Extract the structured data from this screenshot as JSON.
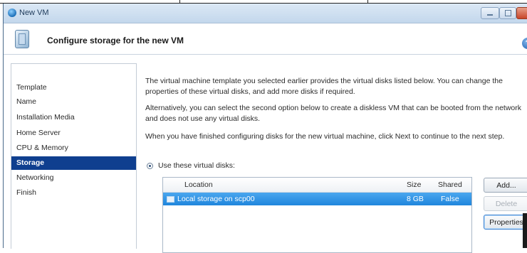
{
  "window": {
    "title": "New VM",
    "icon": "xen-orb-icon"
  },
  "header": {
    "title": "Configure storage for the new VM",
    "icon": "storage-wizard-icon",
    "help_glyph": "?"
  },
  "sidebar": {
    "items": [
      {
        "label": "Template",
        "active": false
      },
      {
        "label": "Name",
        "active": false
      },
      {
        "label": "Installation Media",
        "active": false
      },
      {
        "label": "Home Server",
        "active": false
      },
      {
        "label": "CPU & Memory",
        "active": false
      },
      {
        "label": "Storage",
        "active": true
      },
      {
        "label": "Networking",
        "active": false
      },
      {
        "label": "Finish",
        "active": false
      }
    ]
  },
  "content": {
    "para1": "The virtual machine template you selected earlier provides the virtual disks listed below. You can change the properties of these virtual disks, and add more disks if required.",
    "para2": "Alternatively, you can select the second option below to create a diskless VM that can be booted from the network and does not use any virtual disks.",
    "para3": "When you have finished configuring disks for the new virtual machine, click Next to continue to the next step.",
    "radio_label": "Use these virtual disks:"
  },
  "disk_table": {
    "columns": [
      "Location",
      "Size",
      "Shared"
    ],
    "rows": [
      {
        "location": "Local storage on scp00",
        "size": "8 GB",
        "shared": "False",
        "selected": true
      }
    ]
  },
  "buttons": {
    "add": "Add...",
    "delete": "Delete",
    "properties": "Properties"
  },
  "colors": {
    "selection": "#1f86dc",
    "active_nav": "#0f3f8f"
  }
}
